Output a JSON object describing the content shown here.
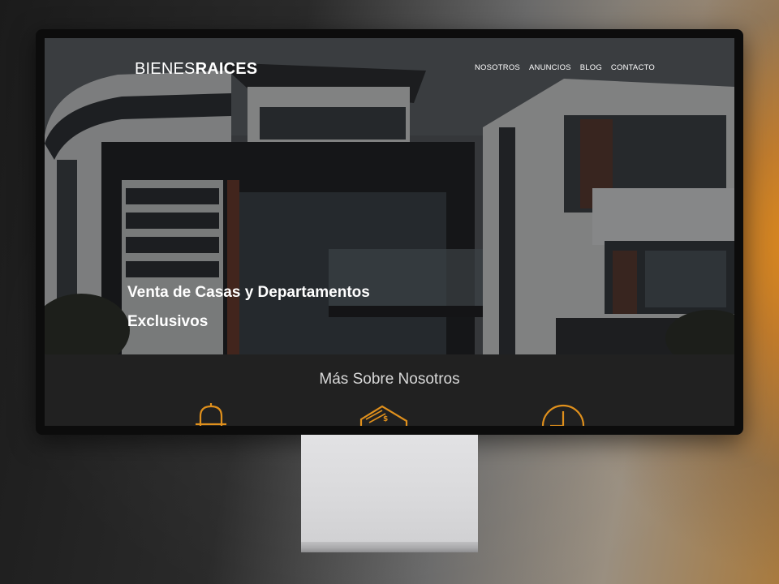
{
  "site": {
    "logo_light": "BIENES",
    "logo_bold": "RAICES"
  },
  "nav": {
    "items": [
      "NOSOTROS",
      "ANUNCIOS",
      "BLOG",
      "CONTACTO"
    ]
  },
  "hero": {
    "title": "Venta de Casas y Departamentos Exclusivos"
  },
  "about": {
    "title": "Más Sobre Nosotros",
    "icons": [
      "security-icon",
      "price-tag-icon",
      "clock-icon"
    ]
  },
  "colors": {
    "accent": "#e0901c",
    "section_bg": "#212121"
  }
}
